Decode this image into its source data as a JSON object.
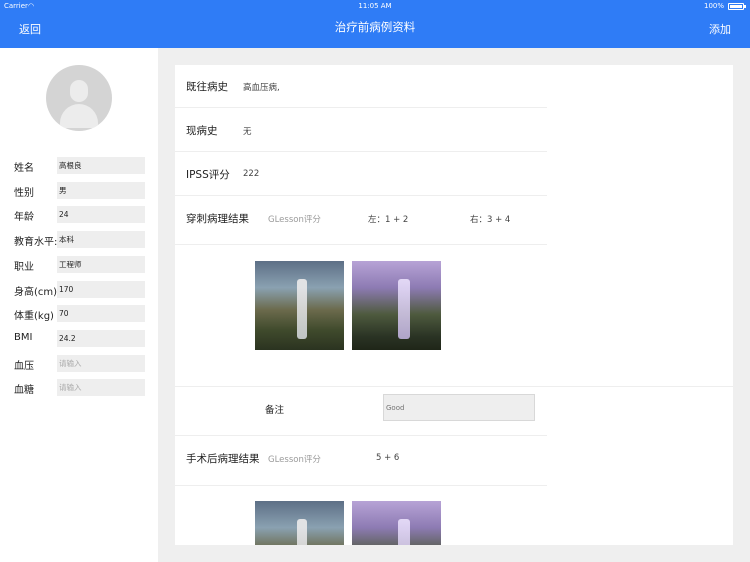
{
  "status": {
    "carrier": "Carrier",
    "time": "11:05 AM",
    "battery": "100%"
  },
  "nav": {
    "back": "返回",
    "title": "治疗前病例资料",
    "add": "添加"
  },
  "patient": [
    {
      "label": "姓名",
      "value": "高根良",
      "placeholder": ""
    },
    {
      "label": "性别",
      "value": "男",
      "placeholder": ""
    },
    {
      "label": "年龄",
      "value": "24",
      "placeholder": ""
    },
    {
      "label": "教育水平:",
      "value": "本科",
      "placeholder": ""
    },
    {
      "label": "职业",
      "value": "工程师",
      "placeholder": ""
    },
    {
      "label": "身高(cm)",
      "value": "170",
      "placeholder": ""
    },
    {
      "label": "体重(kg)",
      "value": "70",
      "placeholder": ""
    },
    {
      "label": "BMI",
      "value": "24.2",
      "placeholder": ""
    },
    {
      "label": "血压",
      "value": "",
      "placeholder": "请输入"
    },
    {
      "label": "血糖",
      "value": "",
      "placeholder": "请输入"
    }
  ],
  "record": {
    "history": {
      "label": "既往病史",
      "value": "高血压病,"
    },
    "current": {
      "label": "现病史",
      "value": "无"
    },
    "ipss": {
      "label": "IPSS评分",
      "value": "222"
    },
    "biopsy": {
      "label": "穿刺病理结果",
      "sub": "GLesson评分",
      "left": "左：1 + 2",
      "right": "右：3 + 4"
    },
    "remark": {
      "label": "备注",
      "placeholder": "Good"
    },
    "postop": {
      "label": "手术后病理结果",
      "sub": "GLesson评分",
      "value": "5 + 6"
    }
  },
  "colors": {
    "navbar": "#2f7cf6",
    "background": "#efefef"
  }
}
